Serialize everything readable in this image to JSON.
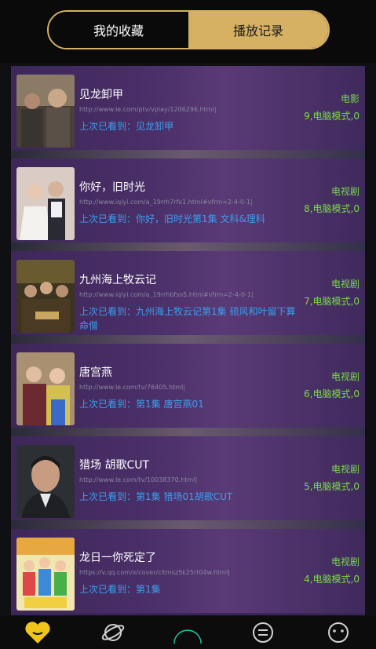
{
  "tabs": [
    {
      "label": "我的收藏",
      "active": false
    },
    {
      "label": "播放记录",
      "active": true
    }
  ],
  "colors": {
    "accent": "#d6b163",
    "link": "#3a9ff0",
    "type_green": "#7ad94a"
  },
  "items": [
    {
      "title": "见龙卸甲",
      "url": "http://www.le.com/ptv/vplay/1206296.html|",
      "last": "上次已看到：见龙卸甲",
      "type": "电影",
      "mode": "9,电脑模式,0"
    },
    {
      "title": "你好，旧时光",
      "url": "http://www.iqiyi.com/a_19rrh7rfx1.html#vfrm=2-4-0-1|",
      "last": "上次已看到：你好，旧时光第1集 文科&理科",
      "type": "电视剧",
      "mode": "8,电脑模式,0"
    },
    {
      "title": "九州海上牧云记",
      "url": "http://www.iqiyi.com/a_19rrhbfso5.html#vfrm=2-4-0-1|",
      "last": "上次已看到：九州海上牧云记第1集 硕风和叶留下算命僧",
      "type": "电视剧",
      "mode": "7,电脑模式,0"
    },
    {
      "title": "唐宫燕",
      "url": "http://www.le.com/tv/76405.html|",
      "last": "上次已看到：第1集 唐宫燕01",
      "type": "电视剧",
      "mode": "6,电脑模式,0"
    },
    {
      "title": "猎场 胡歌CUT",
      "url": "http://www.le.com/tv/10038370.html|",
      "last": "上次已看到：第1集 猎场01胡歌CUT",
      "type": "电视剧",
      "mode": "5,电脑模式,0"
    },
    {
      "title": "龙日一你死定了",
      "url": "https://v.qq.com/x/cover/cltmsz5k25rt04w.html|",
      "last": "上次已看到：第1集",
      "type": "电视剧",
      "mode": "4,电脑模式,0"
    }
  ],
  "bottom_nav": [
    {
      "icon": "heart-icon"
    },
    {
      "icon": "planet-icon"
    },
    {
      "icon": "circle-icon"
    },
    {
      "icon": "chat-icon"
    },
    {
      "icon": "face-icon"
    }
  ]
}
